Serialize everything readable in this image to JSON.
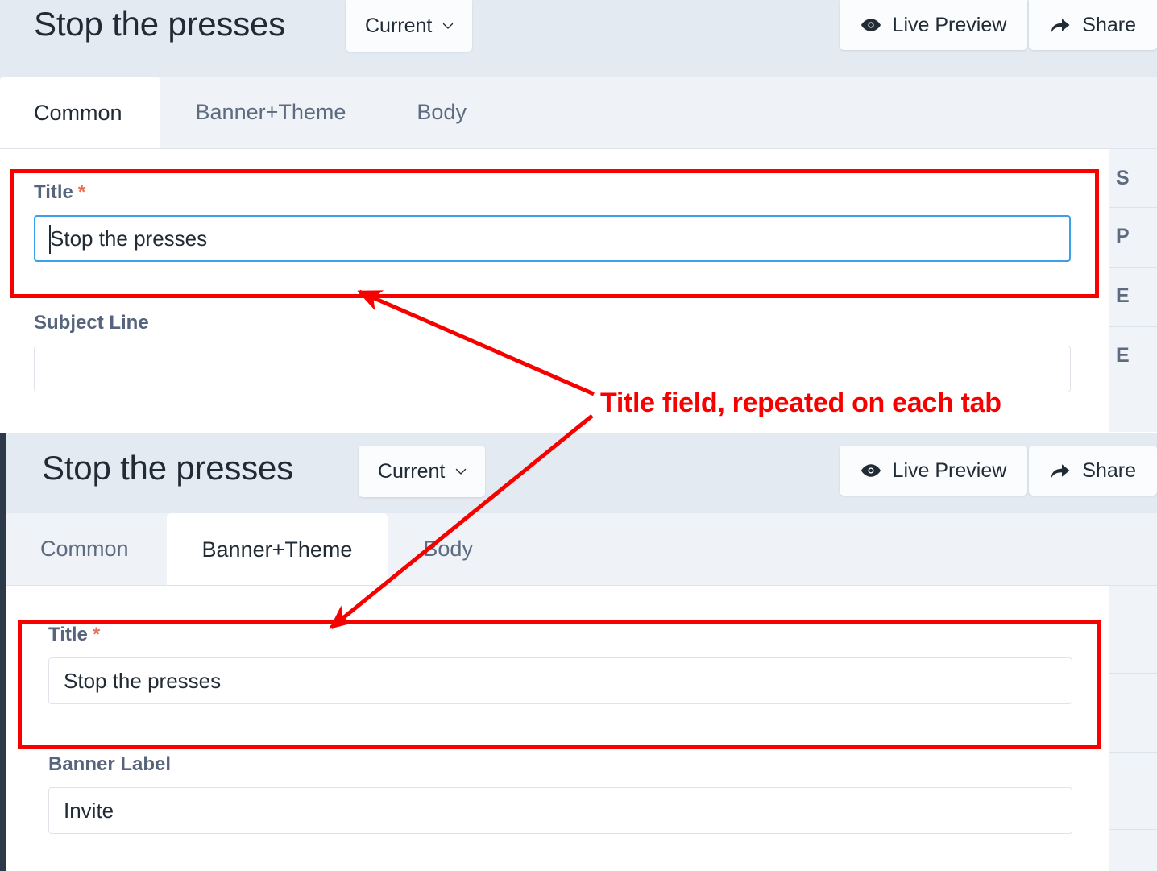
{
  "panels": [
    {
      "header": {
        "title": "Stop the presses",
        "version_label": "Current",
        "version_icon": "chevron-down-icon",
        "actions": [
          {
            "label": "Live Preview",
            "icon": "eye-icon"
          },
          {
            "label": "Share",
            "icon": "share-arrow-icon"
          }
        ]
      },
      "tabs": [
        {
          "label": "Common",
          "active": true
        },
        {
          "label": "Banner+Theme",
          "active": false
        },
        {
          "label": "Body",
          "active": false
        }
      ],
      "fields": [
        {
          "label": "Title",
          "required": true,
          "value": "Stop the presses",
          "placeholder": "",
          "focused": true
        },
        {
          "label": "Subject Line",
          "required": false,
          "value": "",
          "placeholder": "",
          "focused": false
        }
      ],
      "side_rail": [
        "S",
        "P",
        "E",
        "E"
      ]
    },
    {
      "header": {
        "title": "Stop the presses",
        "version_label": "Current",
        "version_icon": "chevron-down-icon",
        "actions": [
          {
            "label": "Live Preview",
            "icon": "eye-icon"
          },
          {
            "label": "Share",
            "icon": "share-arrow-icon"
          }
        ]
      },
      "tabs": [
        {
          "label": "Common",
          "active": false
        },
        {
          "label": "Banner+Theme",
          "active": true
        },
        {
          "label": "Body",
          "active": false
        }
      ],
      "fields": [
        {
          "label": "Title",
          "required": true,
          "value": "Stop the presses",
          "placeholder": "",
          "focused": false
        },
        {
          "label": "Banner Label",
          "required": false,
          "value": "Invite",
          "placeholder": "",
          "focused": false
        }
      ],
      "side_rail": [
        "",
        "",
        "",
        ""
      ]
    }
  ],
  "annotation": {
    "text": "Title field, repeated on each tab",
    "color": "#f60000"
  },
  "colors": {
    "header_bg": "#e4eaf1",
    "tabbar_bg": "#eff2f6",
    "panel_bg": "#ffffff",
    "rail_bg": "#f0f3f7",
    "left_rail": "#2b3949",
    "label_text": "#56657b",
    "required_asterisk": "#e8705b",
    "focus_border": "#3aa0e8",
    "annotation": "#f60000"
  }
}
